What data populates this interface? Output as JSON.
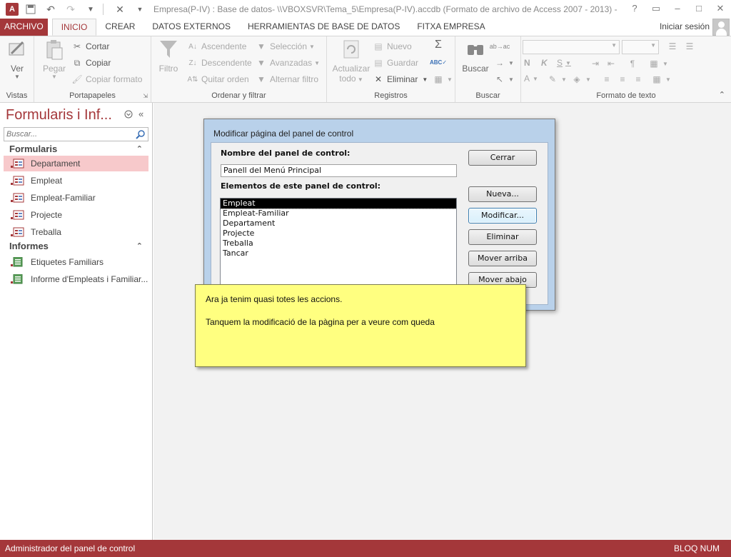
{
  "titlebar": {
    "title": "Empresa(P-IV) : Base de datos- \\\\VBOXSVR\\Tema_5\\Empresa(P-IV).accdb (Formato de archivo de Access 2007 - 2013) - A...",
    "app_icon": "A",
    "window_controls": [
      "?",
      "▭",
      "–",
      "□",
      "✕"
    ]
  },
  "tabs": {
    "file": "ARCHIVO",
    "items": [
      "INICIO",
      "CREAR",
      "DATOS EXTERNOS",
      "HERRAMIENTAS DE BASE DE DATOS",
      "FITXA EMPRESA"
    ],
    "active": "INICIO",
    "signin": "Iniciar sesión"
  },
  "ribbon": {
    "vistas": {
      "label": "Vistas",
      "ver": "Ver"
    },
    "portapapeles": {
      "label": "Portapapeles",
      "pegar": "Pegar",
      "cortar": "Cortar",
      "copiar": "Copiar",
      "copiar_formato": "Copiar formato"
    },
    "ordenar": {
      "label": "Ordenar y filtrar",
      "filtro": "Filtro",
      "ascendente": "Ascendente",
      "descendente": "Descendente",
      "quitar_orden": "Quitar orden",
      "seleccion": "Selección",
      "avanzadas": "Avanzadas",
      "alternar_filtro": "Alternar filtro"
    },
    "registros": {
      "label": "Registros",
      "actualizar": "Actualizar",
      "todo": "todo",
      "nuevo": "Nuevo",
      "guardar": "Guardar",
      "eliminar": "Eliminar"
    },
    "buscar": {
      "label": "Buscar",
      "buscar": "Buscar"
    },
    "formato": {
      "label": "Formato de texto",
      "n": "N",
      "k": "K",
      "s": "S",
      "a": "A"
    }
  },
  "nav": {
    "title": "Formularis i Inf...",
    "search_placeholder": "Buscar...",
    "sections": [
      {
        "label": "Formularis",
        "items": [
          "Departament",
          "Empleat",
          "Empleat-Familiar",
          "Projecte",
          "Treballa"
        ]
      },
      {
        "label": "Informes",
        "items": [
          "Etiquetes Familiars",
          "Informe d'Empleats i Familiar..."
        ]
      }
    ],
    "selected": "Departament"
  },
  "dialog": {
    "title": "Modificar página del panel de control",
    "name_label": "Nombre del panel de control:",
    "name_value": "Panell del Menú Principal",
    "items_label": "Elementos de este panel de control:",
    "items": [
      "Empleat",
      "Empleat-Familiar",
      "Departament",
      "Projecte",
      "Treballa",
      "Tancar"
    ],
    "selected_item": "Empleat",
    "buttons": {
      "cerrar": "Cerrar",
      "nueva": "Nueva...",
      "modificar": "Modificar...",
      "eliminar": "Eliminar",
      "mover_arriba": "Mover arriba",
      "mover_abajo": "Mover abajo"
    }
  },
  "note": {
    "line1": "Ara ja tenim quasi totes les accions.",
    "line2": "Tanquem la modificació de la pàgina per a veure com queda"
  },
  "statusbar": {
    "left": "Administrador del panel de control",
    "right": "BLOQ NUM"
  },
  "colors": {
    "accent": "#a4373a",
    "selected_nav": "#f7c9cb",
    "note_bg": "#ffff80",
    "dialog_frame": "#b9d1ea"
  }
}
